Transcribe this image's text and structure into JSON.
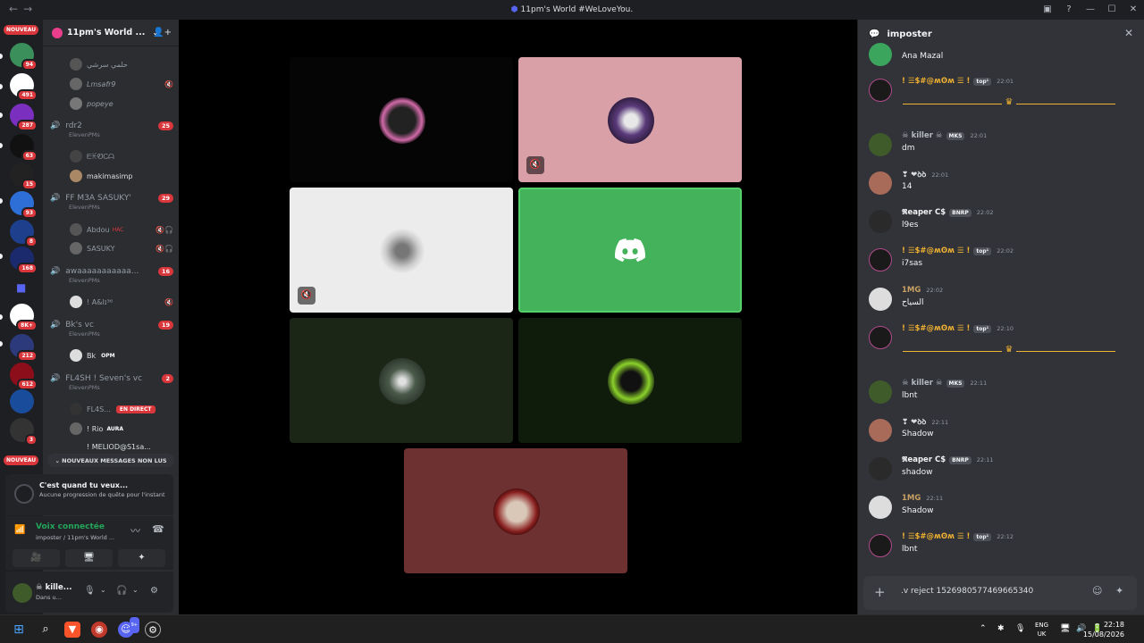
{
  "window": {
    "title": "11pm's World #WeLoveYou.",
    "back_glyph": "←",
    "forward_glyph": "→",
    "controls": [
      "▣",
      "?",
      "—",
      "☐",
      "✕"
    ]
  },
  "servers": {
    "nouveau_top": "NOUVEAU",
    "nouveau_bottom": "NOUVEAU",
    "badges": [
      "94",
      "491",
      "287",
      "63",
      "15",
      "93",
      "8",
      "168",
      "8K+",
      "212",
      "612",
      "3"
    ]
  },
  "guild": {
    "name": "11pm's World ...",
    "chevron": "⌄",
    "invite_glyph": "👤+"
  },
  "channels": {
    "top_members": [
      "حلمي سرشي",
      "Lmsafr9",
      "popeye"
    ],
    "voice": [
      {
        "name": "rdr2",
        "sub": "ElevenPMs",
        "badge": "25",
        "members": [
          "ᗴꀘᏬᏟᗩ",
          "makimasimp"
        ]
      },
      {
        "name": "FF M3A SASUKY'",
        "sub": "ElevenPMs",
        "badge": "29",
        "members": [
          "Abdou",
          "SASUKY"
        ]
      },
      {
        "name": "awaaaaaaaaaaa...",
        "sub": "ElevenPMs",
        "badge": "16",
        "members": [
          "! A&lɪ³⁶"
        ]
      },
      {
        "name": "Bk's vc",
        "sub": "ElevenPMs",
        "badge": "19",
        "members": [
          "Bk"
        ]
      },
      {
        "name": "FL4SH ! Seven's vc",
        "sub": "ElevenPMs",
        "badge": "2",
        "members": [
          "FL4S...",
          "! Rio",
          "! MELIOD@S1sa..."
        ]
      }
    ],
    "tags": {
      "abdou": "HAC",
      "bk": "OPM",
      "live": "EN DIRECT",
      "rio": "AURA"
    },
    "unread": "⌄ NOUVEAUX MESSAGES NON LUS"
  },
  "quest": {
    "title": "C'est quand tu veux...",
    "subtitle": "Aucune progression de quête pour l'instant"
  },
  "voice_panel": {
    "status": "Voix connectée",
    "location": "imposter / 11pm's World ...",
    "signal_glyph": "📶",
    "noise_glyph": "〰",
    "hangup_glyph": "☎",
    "buttons": [
      "🎥",
      "🖥",
      "✦"
    ]
  },
  "user_panel": {
    "name": "☠ kille...",
    "status": "Dans u...",
    "controls": [
      "🎙",
      "⌄",
      "🎧",
      "⌄",
      "⚙"
    ]
  },
  "stage": {
    "mute_glyph": "🔇"
  },
  "chat": {
    "channel": "imposter",
    "bubble_glyph": "💬",
    "close_glyph": "✕",
    "messages": [
      {
        "name": "",
        "time": "",
        "text": "Ana Mazal"
      },
      {
        "name": "! ☰$#@ʍʘʍ ☰ !",
        "chip": "top¹",
        "time": "22:01",
        "text": ""
      },
      {
        "name": "☠ killer ☠",
        "chip": "MKS",
        "time": "22:01",
        "text": "dm"
      },
      {
        "name": "❣ ❤ꝺꝺ",
        "chip": "",
        "time": "22:01",
        "text": "14"
      },
      {
        "name": "𝕽eaper C$",
        "chip": "BNRP",
        "time": "22:02",
        "text": "l9es"
      },
      {
        "name": "! ☰$#@ʍʘʍ ☰ !",
        "chip": "top¹",
        "time": "22:02",
        "text": "i7sas"
      },
      {
        "name": "1MG",
        "chip": "",
        "time": "22:02",
        "text": "السياح"
      },
      {
        "name": "! ☰$#@ʍʘʍ ☰ !",
        "chip": "top¹",
        "time": "22:10",
        "text": ""
      },
      {
        "name": "☠ killer ☠",
        "chip": "MKS",
        "time": "22:11",
        "text": "lbnt"
      },
      {
        "name": "❣ ❤ꝺꝺ",
        "chip": "",
        "time": "22:11",
        "text": "Shadow"
      },
      {
        "name": "𝕽eaper C$",
        "chip": "BNRP",
        "time": "22:11",
        "text": "shadow"
      },
      {
        "name": "1MG",
        "chip": "",
        "time": "22:11",
        "text": "Shadow"
      },
      {
        "name": "! ☰$#@ʍʘʍ ☰ !",
        "chip": "top¹",
        "time": "22:12",
        "text": "lbnt"
      }
    ],
    "crown_glyph": "♛",
    "composer_value": ".v reject 1526980577469665340",
    "composer_plus": "+",
    "composer_icons": [
      "☺",
      "✦"
    ]
  },
  "taskbar": {
    "lang": "ENG",
    "region": "UK",
    "time": "22:18",
    "date": "15/08/2026",
    "discord_badge": "9+",
    "tray_icons": [
      "⌃",
      "✱",
      "🎙",
      "🖥",
      "🔊",
      "🔋"
    ]
  },
  "colors": {
    "accent_green": "#23a55a",
    "badge_red": "#da373c",
    "tile_pink": "#d9a0a8",
    "tile_light": "#ececec",
    "tile_green": "#43b25a",
    "tile_darkgreen": "#1b2617",
    "tile_red": "#6e3131",
    "gold": "#f0b232"
  }
}
